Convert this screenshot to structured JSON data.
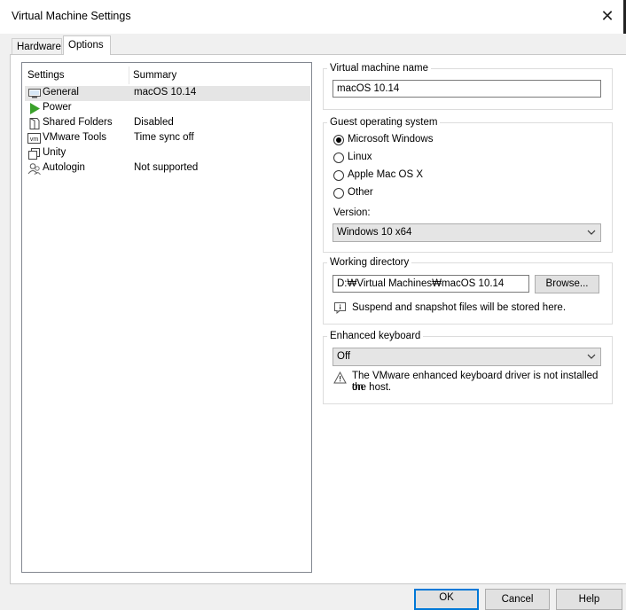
{
  "window": {
    "title": "Virtual Machine Settings",
    "close_glyph": "✕"
  },
  "tabs": [
    {
      "label": "Hardware"
    },
    {
      "label": "Options"
    }
  ],
  "settings_list": {
    "col_settings": "Settings",
    "col_summary": "Summary",
    "items": [
      {
        "label": "General",
        "summary": "macOS 10.14",
        "icon": "monitor-icon"
      },
      {
        "label": "Power",
        "summary": "",
        "icon": "play-icon"
      },
      {
        "label": "Shared Folders",
        "summary": "Disabled",
        "icon": "folder-icon"
      },
      {
        "label": "VMware Tools",
        "summary": "Time sync off",
        "icon": "vm-icon"
      },
      {
        "label": "Unity",
        "summary": "",
        "icon": "unity-icon"
      },
      {
        "label": "Autologin",
        "summary": "Not supported",
        "icon": "users-icon"
      }
    ]
  },
  "vm_name": {
    "title": "Virtual machine name",
    "value": "macOS 10.14"
  },
  "guest_os": {
    "title": "Guest operating system",
    "options": [
      "Microsoft Windows",
      "Linux",
      "Apple Mac OS X",
      "Other"
    ],
    "selected": "Microsoft Windows",
    "version_label": "Version:",
    "version_value": "Windows 10 x64"
  },
  "working_dir": {
    "title": "Working directory",
    "value": "D:₩Virtual Machines₩macOS 10.14",
    "browse_label": "Browse...",
    "info": "Suspend and snapshot files will be stored here."
  },
  "enhanced_keyboard": {
    "title": "Enhanced keyboard",
    "value": "Off",
    "warning_line1": "The VMware enhanced keyboard driver is not installed on",
    "warning_line2": "the host."
  },
  "footer": {
    "ok": "OK",
    "cancel": "Cancel",
    "help": "Help"
  },
  "colors": {
    "accent": "#0078d7",
    "selection": "#e5e5e5",
    "power_green": "#3aa12b"
  }
}
